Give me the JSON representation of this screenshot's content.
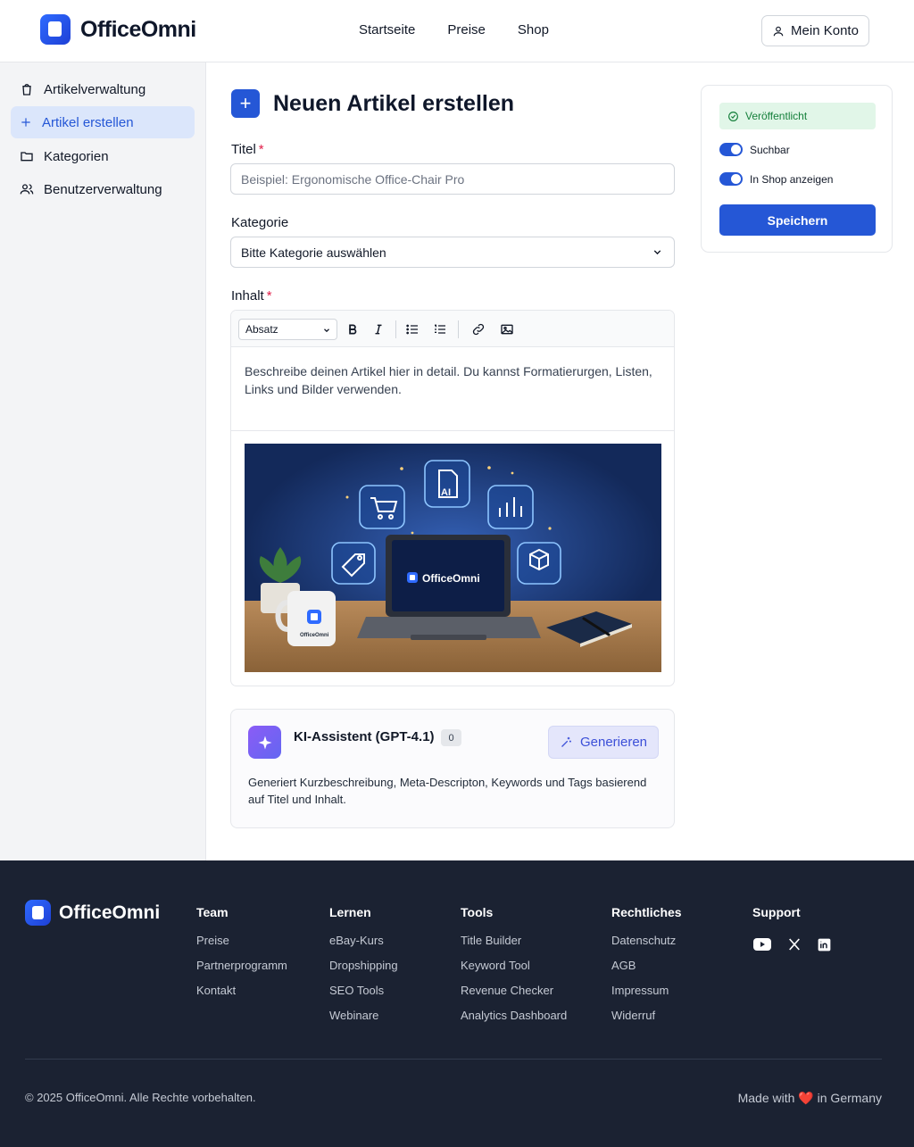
{
  "brand": {
    "name": "OfficeOmni"
  },
  "topnav": {
    "items": [
      "Startseite",
      "Preise",
      "Shop"
    ],
    "account_label": "Mein Konto"
  },
  "sidebar": {
    "items": [
      {
        "label": "Artikelverwaltung",
        "icon": "shopping-bag-icon",
        "active": false
      },
      {
        "label": "Artikel erstellen",
        "icon": "plus-icon",
        "active": true
      },
      {
        "label": "Kategorien",
        "icon": "folder-icon",
        "active": false
      },
      {
        "label": "Benutzerverwaltung",
        "icon": "users-icon",
        "active": false
      }
    ]
  },
  "main": {
    "title": "Neuen Artikel erstellen",
    "title_label": "Titel",
    "title_placeholder": "Beispiel: Ergonomische Office-Chair Pro",
    "category_label": "Kategorie",
    "category_value": "Bitte Kategorie auswählen",
    "content_label": "Inhalt",
    "required_mark": "*",
    "editor": {
      "block_format": "Absatz",
      "text": "Beschreibe deinen Artikel hier in detail. Du kannst Formatierurgen, Listen, Links und Bilder verwenden.",
      "image_caption": "OfficeOmni",
      "mug_label": "OfficeOmni"
    },
    "ai": {
      "title": "KI-Assistent (GPT-4.1)",
      "count": "0",
      "button_label": "Generieren",
      "description": "Generiert Kurzbeschreibung, Meta-Descripton, Keywords und Tags basierend auf Titel und Inhalt."
    }
  },
  "publish": {
    "status": "Veröffentlicht",
    "toggle_searchable": "Suchbar",
    "toggle_shop": "In Shop anzeigen",
    "save_label": "Speichern"
  },
  "footer": {
    "columns": [
      {
        "heading": "Team",
        "links": [
          "Preise",
          "Partnerprogramm",
          "Kontakt"
        ]
      },
      {
        "heading": "Lernen",
        "links": [
          "eBay-Kurs",
          "Dropshipping",
          "SEO Tools",
          "Webinare"
        ]
      },
      {
        "heading": "Tools",
        "links": [
          "Title Builder",
          "Keyword Tool",
          "Revenue Checker",
          "Analytics Dashboard"
        ]
      },
      {
        "heading": "Rechtliches",
        "links": [
          "Datenschutz",
          "AGB",
          "Impressum",
          "Widerruf"
        ]
      },
      {
        "heading": "Support",
        "links": []
      }
    ],
    "copyright": "© 2025 OfficeOmni. Alle Rechte vorbehalten.",
    "made_prefix": "Made with",
    "made_heart": "❤️",
    "made_suffix": "in Germany"
  },
  "colors": {
    "accent": "#2557d6",
    "footer_bg": "#1b2232",
    "success_bg": "#e1f6e8",
    "success_text": "#16803c",
    "ai_accent": "#8b5cf6"
  }
}
